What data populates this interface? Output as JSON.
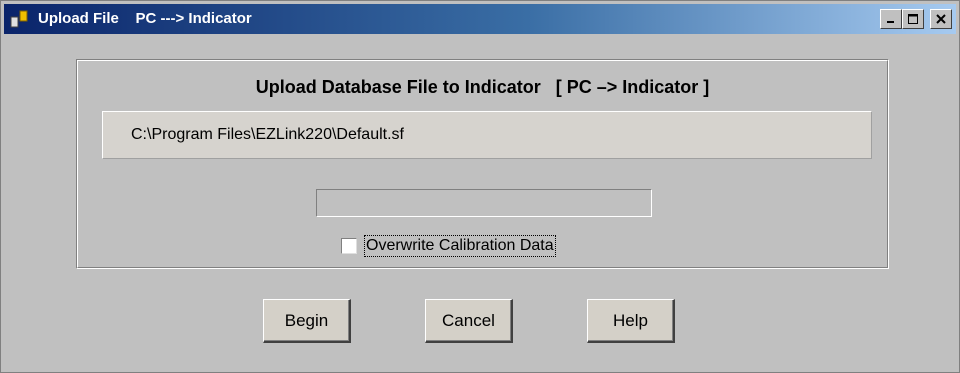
{
  "window": {
    "title": "Upload File    PC ---> Indicator"
  },
  "titlebar_buttons": {
    "minimize": "minimize-icon",
    "maximize": "maximize-icon",
    "close": "close-icon"
  },
  "dialog": {
    "heading": "Upload Database File to Indicator   [ PC –> Indicator ]",
    "file_path": "C:\\Program Files\\EZLink220\\Default.sf",
    "progress": 0,
    "overwrite_label": "Overwrite Calibration Data",
    "overwrite_checked": false
  },
  "buttons": {
    "begin": "Begin",
    "cancel": "Cancel",
    "help": "Help"
  },
  "colors": {
    "title_gradient_start": "#0a246a",
    "title_gradient_end": "#a6caf0",
    "face": "#c0c0c0"
  }
}
